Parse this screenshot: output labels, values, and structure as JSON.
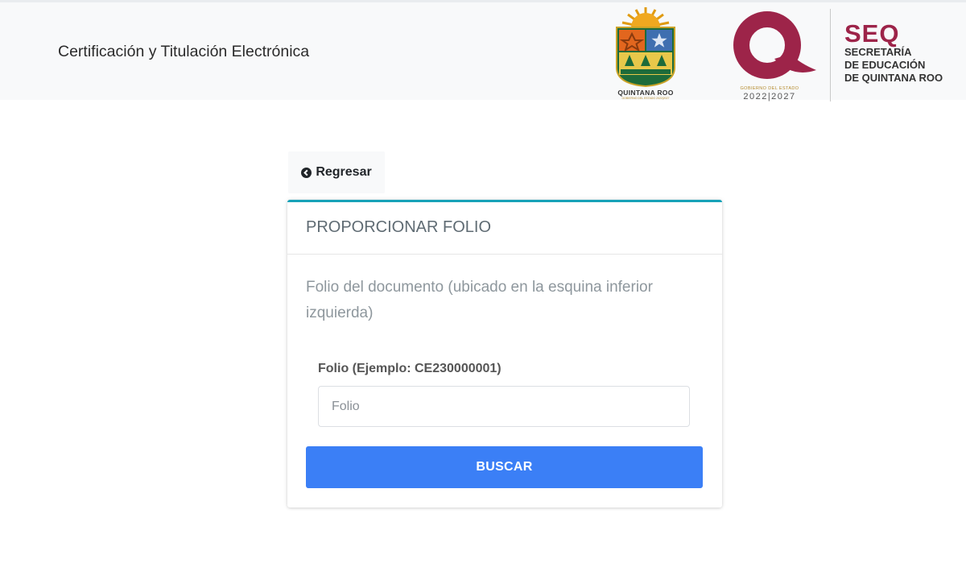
{
  "header": {
    "title": "Certificación y Titulación Electrónica",
    "qroo_logo": {
      "name": "QUINTANA ROO",
      "sub": "GOBIERNO DEL ESTADO 2022|2027"
    },
    "q_logo": {
      "sub": "GOBIERNO DEL ESTADO",
      "years": "2022|2027"
    },
    "seq_logo": {
      "abbr": "SEQ",
      "lines": [
        "SECRETARÍA",
        "DE EDUCACIÓN",
        "DE QUINTANA ROO"
      ]
    }
  },
  "back_button": {
    "label": "Regresar",
    "icon": "chevron-circle-left-icon"
  },
  "card": {
    "title": "PROPORCIONAR FOLIO",
    "description": "Folio del documento (ubicado en la esquina inferior izquierda)",
    "field_label": "Folio (Ejemplo: CE230000001)",
    "input": {
      "value": "",
      "placeholder": "Folio"
    },
    "search_button": "BUSCAR"
  },
  "colors": {
    "accent_top": "#17a2b8",
    "primary_button": "#3b7ff6",
    "seq_brand": "#9d2449"
  }
}
